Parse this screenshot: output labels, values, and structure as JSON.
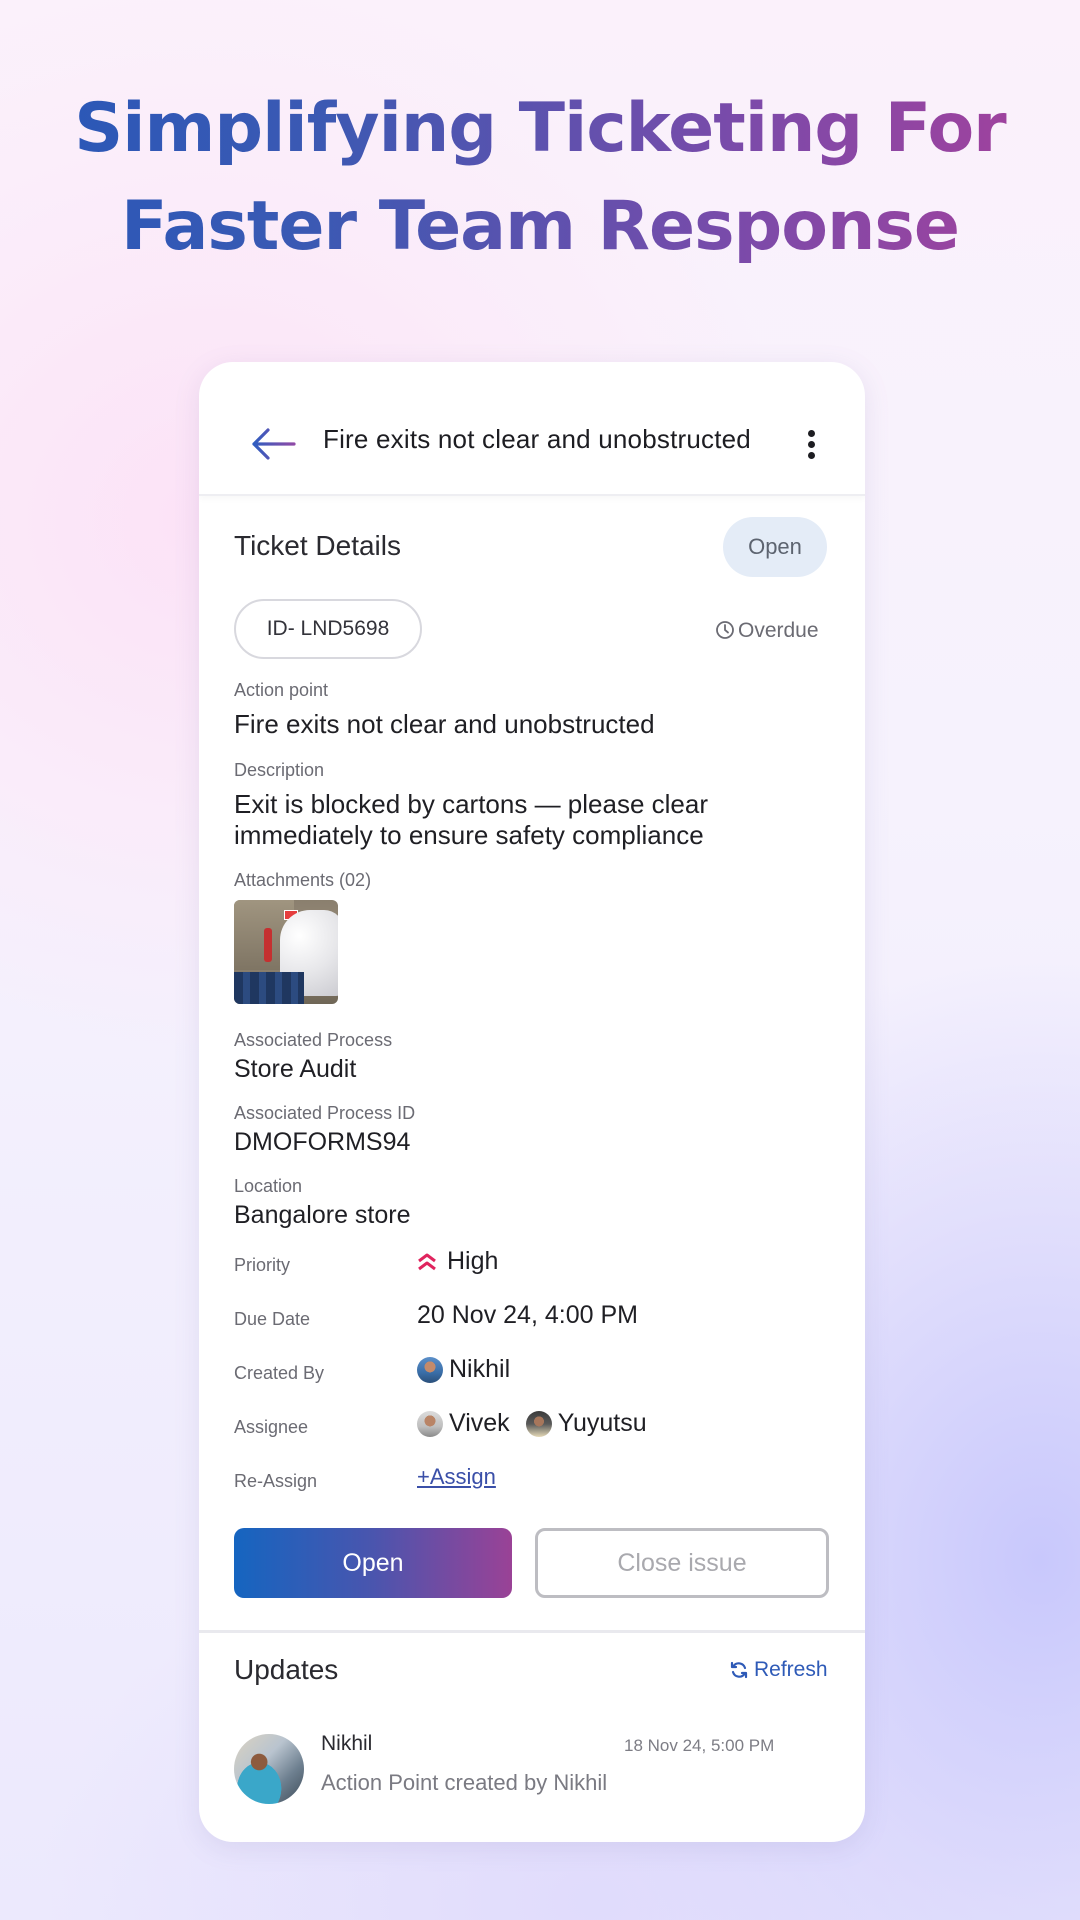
{
  "headline": {
    "line1": "Simplifying Ticketing For",
    "line2": "Faster Team Response"
  },
  "topbar": {
    "back_icon": "arrow-left-icon",
    "title": "Fire exits not clear and unobstructed",
    "more_icon": "more-vertical-icon"
  },
  "ticket": {
    "section_title": "Ticket Details",
    "status": "Open",
    "id": "ID- LND5698",
    "overdue_icon": "clock-icon",
    "overdue": "Overdue",
    "action_point_label": "Action point",
    "action_point": "Fire exits not clear and unobstructed",
    "description_label": "Description",
    "description": "Exit is blocked by cartons — please clear immediately to ensure safety compliance",
    "attachments_label": "Attachments (02)",
    "associated_process_label": "Associated Process",
    "associated_process": "Store Audit",
    "associated_process_id_label": "Associated Process ID",
    "associated_process_id": "DMOFORMS94",
    "location_label": "Location",
    "location": "Bangalore store",
    "priority_label": "Priority",
    "priority": "High",
    "priority_color": "#e0245e",
    "due_date_label": "Due Date",
    "due_date": "20 Nov 24, 4:00 PM",
    "created_by_label": "Created By",
    "created_by": "Nikhil",
    "assignee_label": "Assignee",
    "assignees": [
      "Vivek",
      "Yuyutsu"
    ],
    "reassign_label": "Re-Assign",
    "reassign_link": "+Assign"
  },
  "actions": {
    "open_button": "Open",
    "close_button": "Close issue"
  },
  "updates": {
    "section_title": "Updates",
    "refresh_icon": "refresh-icon",
    "refresh": "Refresh",
    "items": [
      {
        "name": "Nikhil",
        "time": "18 Nov 24, 5:00 PM",
        "text": "Action Point created by Nikhil"
      }
    ]
  },
  "colors": {
    "accent_blue": "#1565c0",
    "accent_purple": "#9a4296",
    "link": "#3a4fa8"
  }
}
